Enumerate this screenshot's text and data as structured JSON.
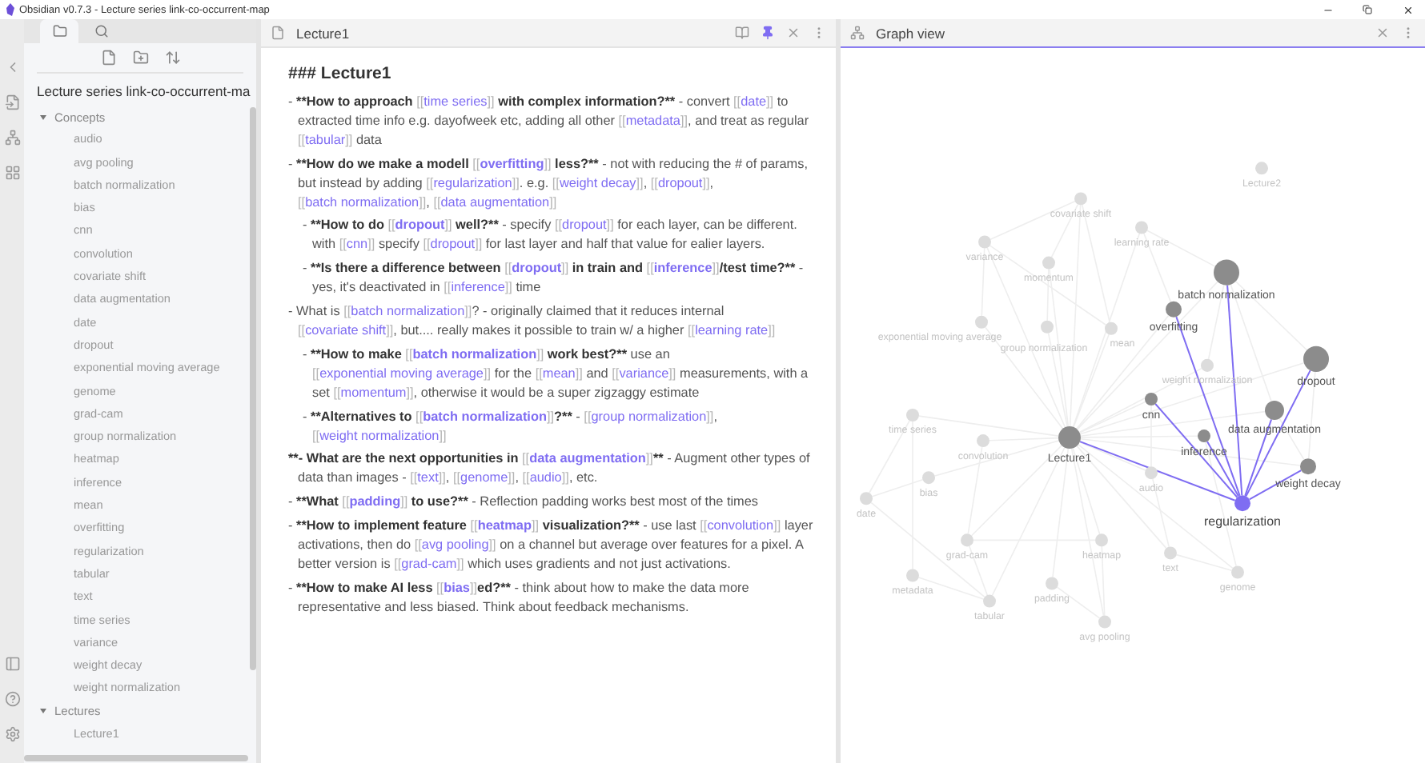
{
  "window": {
    "title": "Obsidian v0.7.3 - Lecture series link-co-occurrent-map"
  },
  "sidebar_tabs": [
    {
      "kind": "folder",
      "selected": true
    },
    {
      "kind": "search",
      "selected": false
    }
  ],
  "file_tree": {
    "vault": "Lecture series link-co-occurrent-ma",
    "folders": [
      {
        "label": "Concepts",
        "expanded": true,
        "children": [
          "audio",
          "avg pooling",
          "batch normalization",
          "bias",
          "cnn",
          "convolution",
          "covariate shift",
          "data augmentation",
          "date",
          "dropout",
          "exponential moving average",
          "genome",
          "grad-cam",
          "group normalization",
          "heatmap",
          "inference",
          "mean",
          "overfitting",
          "regularization",
          "tabular",
          "text",
          "time series",
          "variance",
          "weight decay",
          "weight normalization"
        ]
      },
      {
        "label": "Lectures",
        "expanded": true,
        "children": [
          "Lecture1"
        ]
      }
    ]
  },
  "editor": {
    "title": "Lecture1",
    "active": false,
    "pinned": true,
    "heading": "### Lecture1",
    "items": [
      {
        "parts": [
          {
            "kind": "plain",
            "text": "- "
          },
          {
            "kind": "bold",
            "text": "**How to approach "
          },
          {
            "kind": "bracket",
            "text": "[["
          },
          {
            "kind": "link",
            "text": "time series"
          },
          {
            "kind": "bracket",
            "text": "]]"
          },
          {
            "kind": "bold",
            "text": " with complex information?**"
          },
          {
            "kind": "plain",
            "text": " - convert "
          },
          {
            "kind": "bracket",
            "text": "[["
          },
          {
            "kind": "link",
            "text": "date"
          },
          {
            "kind": "bracket",
            "text": "]]"
          },
          {
            "kind": "plain",
            "text": " to extracted time info e.g. dayofweek etc, adding all other "
          },
          {
            "kind": "bracket",
            "text": "[["
          },
          {
            "kind": "link",
            "text": "metadata"
          },
          {
            "kind": "bracket",
            "text": "]]"
          },
          {
            "kind": "plain",
            "text": ", and treat as regular "
          },
          {
            "kind": "bracket",
            "text": "[["
          },
          {
            "kind": "link",
            "text": "tabular"
          },
          {
            "kind": "bracket",
            "text": "]]"
          },
          {
            "kind": "plain",
            "text": " data"
          }
        ]
      },
      {
        "parts": [
          {
            "kind": "plain",
            "text": "- "
          },
          {
            "kind": "bold",
            "text": "**How do we make a modell "
          },
          {
            "kind": "bracket",
            "text": "[["
          },
          {
            "kind": "bold_link",
            "text": "overfitting"
          },
          {
            "kind": "bracket",
            "text": "]]"
          },
          {
            "kind": "bold",
            "text": " less?**"
          },
          {
            "kind": "plain",
            "text": " - not with reducing the # of params, but instead by adding "
          },
          {
            "kind": "bracket",
            "text": "[["
          },
          {
            "kind": "link",
            "text": "regularization"
          },
          {
            "kind": "bracket",
            "text": "]]"
          },
          {
            "kind": "plain",
            "text": ". e.g. "
          },
          {
            "kind": "bracket",
            "text": "[["
          },
          {
            "kind": "link",
            "text": "weight decay"
          },
          {
            "kind": "bracket",
            "text": "]]"
          },
          {
            "kind": "plain",
            "text": ", "
          },
          {
            "kind": "bracket",
            "text": "[["
          },
          {
            "kind": "link",
            "text": "dropout"
          },
          {
            "kind": "bracket",
            "text": "]]"
          },
          {
            "kind": "plain",
            "text": ", "
          },
          {
            "kind": "bracket",
            "text": "[["
          },
          {
            "kind": "link",
            "text": "batch normalization"
          },
          {
            "kind": "bracket",
            "text": "]]"
          },
          {
            "kind": "plain",
            "text": ", "
          },
          {
            "kind": "bracket",
            "text": "[["
          },
          {
            "kind": "link",
            "text": "data augmentation"
          },
          {
            "kind": "bracket",
            "text": "]]"
          }
        ],
        "children": [
          {
            "parts": [
              {
                "kind": "plain",
                "text": "- "
              },
              {
                "kind": "bold",
                "text": "**How to do "
              },
              {
                "kind": "bracket",
                "text": "[["
              },
              {
                "kind": "bold_link",
                "text": "dropout"
              },
              {
                "kind": "bracket",
                "text": "]]"
              },
              {
                "kind": "bold",
                "text": " well?**"
              },
              {
                "kind": "plain",
                "text": " - specify "
              },
              {
                "kind": "bracket",
                "text": "[["
              },
              {
                "kind": "link",
                "text": "dropout"
              },
              {
                "kind": "bracket",
                "text": "]]"
              },
              {
                "kind": "plain",
                "text": " for each layer, can be different. with "
              },
              {
                "kind": "bracket",
                "text": "[["
              },
              {
                "kind": "link",
                "text": "cnn"
              },
              {
                "kind": "bracket",
                "text": "]]"
              },
              {
                "kind": "plain",
                "text": " specify "
              },
              {
                "kind": "bracket",
                "text": "[["
              },
              {
                "kind": "link",
                "text": "dropout"
              },
              {
                "kind": "bracket",
                "text": "]]"
              },
              {
                "kind": "plain",
                "text": " for last layer and half that value for ealier layers."
              }
            ]
          },
          {
            "parts": [
              {
                "kind": "plain",
                "text": "- "
              },
              {
                "kind": "bold",
                "text": "**Is there a difference between "
              },
              {
                "kind": "bracket",
                "text": "[["
              },
              {
                "kind": "bold_link",
                "text": "dropout"
              },
              {
                "kind": "bracket",
                "text": "]]"
              },
              {
                "kind": "bold",
                "text": " in train and "
              },
              {
                "kind": "bracket",
                "text": "[["
              },
              {
                "kind": "bold_link",
                "text": "inference"
              },
              {
                "kind": "bracket",
                "text": "]]"
              },
              {
                "kind": "bold",
                "text": "/test time?**"
              },
              {
                "kind": "plain",
                "text": " - yes, it's deactivated in "
              },
              {
                "kind": "bracket",
                "text": "[["
              },
              {
                "kind": "link",
                "text": "inference"
              },
              {
                "kind": "bracket",
                "text": "]]"
              },
              {
                "kind": "plain",
                "text": " time"
              }
            ]
          }
        ]
      },
      {
        "parts": [
          {
            "kind": "plain",
            "text": "- What is "
          },
          {
            "kind": "bracket",
            "text": "[["
          },
          {
            "kind": "link",
            "text": "batch normalization"
          },
          {
            "kind": "bracket",
            "text": "]]"
          },
          {
            "kind": "plain",
            "text": "? - originally claimed that it reduces internal "
          },
          {
            "kind": "bracket",
            "text": "[["
          },
          {
            "kind": "link",
            "text": "covariate shift"
          },
          {
            "kind": "bracket",
            "text": "]]"
          },
          {
            "kind": "plain",
            "text": ", but.... really makes it possible to train w/ a higher "
          },
          {
            "kind": "bracket",
            "text": "[["
          },
          {
            "kind": "link",
            "text": "learning rate"
          },
          {
            "kind": "bracket",
            "text": "]]"
          }
        ],
        "children": [
          {
            "parts": [
              {
                "kind": "plain",
                "text": "- "
              },
              {
                "kind": "bold",
                "text": "**How to make "
              },
              {
                "kind": "bracket",
                "text": "[["
              },
              {
                "kind": "bold_link",
                "text": "batch normalization"
              },
              {
                "kind": "bracket",
                "text": "]]"
              },
              {
                "kind": "bold",
                "text": " work best?**"
              },
              {
                "kind": "plain",
                "text": " use an "
              },
              {
                "kind": "bracket",
                "text": "[["
              },
              {
                "kind": "link",
                "text": "exponential moving average"
              },
              {
                "kind": "bracket",
                "text": "]]"
              },
              {
                "kind": "plain",
                "text": " for the "
              },
              {
                "kind": "bracket",
                "text": "[["
              },
              {
                "kind": "link",
                "text": "mean"
              },
              {
                "kind": "bracket",
                "text": "]]"
              },
              {
                "kind": "plain",
                "text": " and "
              },
              {
                "kind": "bracket",
                "text": "[["
              },
              {
                "kind": "link",
                "text": "variance"
              },
              {
                "kind": "bracket",
                "text": "]]"
              },
              {
                "kind": "plain",
                "text": " measurements, with a set "
              },
              {
                "kind": "bracket",
                "text": "[["
              },
              {
                "kind": "link",
                "text": "momentum"
              },
              {
                "kind": "bracket",
                "text": "]]"
              },
              {
                "kind": "plain",
                "text": ", otherwise it would be a super zigzaggy estimate"
              }
            ]
          },
          {
            "parts": [
              {
                "kind": "plain",
                "text": "- "
              },
              {
                "kind": "bold",
                "text": "**Alternatives to "
              },
              {
                "kind": "bracket",
                "text": "[["
              },
              {
                "kind": "bold_link",
                "text": "batch normalization"
              },
              {
                "kind": "bracket",
                "text": "]]"
              },
              {
                "kind": "bold",
                "text": "?**"
              },
              {
                "kind": "plain",
                "text": " - "
              },
              {
                "kind": "bracket",
                "text": "[["
              },
              {
                "kind": "link",
                "text": "group normalization"
              },
              {
                "kind": "bracket",
                "text": "]]"
              },
              {
                "kind": "plain",
                "text": ", "
              },
              {
                "kind": "bracket",
                "text": "[["
              },
              {
                "kind": "link",
                "text": "weight normalization"
              },
              {
                "kind": "bracket",
                "text": "]]"
              }
            ]
          }
        ]
      },
      {
        "parts": [
          {
            "kind": "bold",
            "text": "**- What are the next opportunities in "
          },
          {
            "kind": "bracket",
            "text": "[["
          },
          {
            "kind": "bold_link",
            "text": "data augmentation"
          },
          {
            "kind": "bracket",
            "text": "]]"
          },
          {
            "kind": "bold",
            "text": "**"
          },
          {
            "kind": "plain",
            "text": " - Augment other types of data than images - "
          },
          {
            "kind": "bracket",
            "text": "[["
          },
          {
            "kind": "link",
            "text": "text"
          },
          {
            "kind": "bracket",
            "text": "]]"
          },
          {
            "kind": "plain",
            "text": ", "
          },
          {
            "kind": "bracket",
            "text": "[["
          },
          {
            "kind": "link",
            "text": "genome"
          },
          {
            "kind": "bracket",
            "text": "]]"
          },
          {
            "kind": "plain",
            "text": ", "
          },
          {
            "kind": "bracket",
            "text": "[["
          },
          {
            "kind": "link",
            "text": "audio"
          },
          {
            "kind": "bracket",
            "text": "]]"
          },
          {
            "kind": "plain",
            "text": ", etc."
          }
        ]
      },
      {
        "parts": [
          {
            "kind": "plain",
            "text": "- "
          },
          {
            "kind": "bold",
            "text": "**What "
          },
          {
            "kind": "bracket",
            "text": "[["
          },
          {
            "kind": "bold_link",
            "text": "padding"
          },
          {
            "kind": "bracket",
            "text": "]]"
          },
          {
            "kind": "bold",
            "text": " to use?**"
          },
          {
            "kind": "plain",
            "text": " - Reflection padding works best most of the times"
          }
        ]
      },
      {
        "parts": [
          {
            "kind": "plain",
            "text": "- "
          },
          {
            "kind": "bold",
            "text": "**How to implement feature "
          },
          {
            "kind": "bracket",
            "text": "[["
          },
          {
            "kind": "bold_link",
            "text": "heatmap"
          },
          {
            "kind": "bracket",
            "text": "]]"
          },
          {
            "kind": "bold",
            "text": " visualization?**"
          },
          {
            "kind": "plain",
            "text": " - use last "
          },
          {
            "kind": "bracket",
            "text": "[["
          },
          {
            "kind": "link",
            "text": "convolution"
          },
          {
            "kind": "bracket",
            "text": "]]"
          },
          {
            "kind": "plain",
            "text": " layer activations, then do "
          },
          {
            "kind": "bracket",
            "text": "[["
          },
          {
            "kind": "link",
            "text": "avg pooling"
          },
          {
            "kind": "bracket",
            "text": "]]"
          },
          {
            "kind": "plain",
            "text": " on a channel but average over features for a pixel. A better version is "
          },
          {
            "kind": "bracket",
            "text": "[["
          },
          {
            "kind": "link",
            "text": "grad-cam"
          },
          {
            "kind": "bracket",
            "text": "]]"
          },
          {
            "kind": "plain",
            "text": " which uses gradients and not just activations."
          }
        ]
      },
      {
        "parts": [
          {
            "kind": "plain",
            "text": "- "
          },
          {
            "kind": "bold",
            "text": "**How to make AI less "
          },
          {
            "kind": "bracket",
            "text": "[["
          },
          {
            "kind": "bold_link",
            "text": "bias"
          },
          {
            "kind": "bracket",
            "text": "]]"
          },
          {
            "kind": "bold",
            "text": "ed?**"
          },
          {
            "kind": "plain",
            "text": " - think about how to make the data more representative and less biased. Think about feedback mechanisms."
          }
        ]
      }
    ]
  },
  "graph": {
    "title": "Graph view",
    "active": true,
    "nodes": [
      {
        "label": "Lecture2",
        "kind": "dim"
      },
      {
        "label": "covariate shift",
        "kind": "dim"
      },
      {
        "label": "learning rate",
        "kind": "dim"
      },
      {
        "label": "variance",
        "kind": "dim"
      },
      {
        "label": "momentum",
        "kind": "dim"
      },
      {
        "label": "batch normalization",
        "kind": "linked"
      },
      {
        "label": "overfitting",
        "kind": "linked"
      },
      {
        "label": "exponential moving average",
        "kind": "dim"
      },
      {
        "label": "group normalization",
        "kind": "dim"
      },
      {
        "label": "mean",
        "kind": "dim"
      },
      {
        "label": "weight normalization",
        "kind": "dim"
      },
      {
        "label": "dropout",
        "kind": "linked"
      },
      {
        "label": "cnn",
        "kind": "linked"
      },
      {
        "label": "data augmentation",
        "kind": "linked"
      },
      {
        "label": "inference",
        "kind": "linked"
      },
      {
        "label": "Lecture1",
        "kind": "linked"
      },
      {
        "label": "weight decay",
        "kind": "linked"
      },
      {
        "label": "regularization",
        "kind": "focus"
      },
      {
        "label": "time series",
        "kind": "dim"
      },
      {
        "label": "convolution",
        "kind": "dim"
      },
      {
        "label": "bias",
        "kind": "dim"
      },
      {
        "label": "date",
        "kind": "dim"
      },
      {
        "label": "audio",
        "kind": "dim"
      },
      {
        "label": "grad-cam",
        "kind": "dim"
      },
      {
        "label": "heatmap",
        "kind": "dim"
      },
      {
        "label": "text",
        "kind": "dim"
      },
      {
        "label": "genome",
        "kind": "dim"
      },
      {
        "label": "metadata",
        "kind": "dim"
      },
      {
        "label": "padding",
        "kind": "dim"
      },
      {
        "label": "tabular",
        "kind": "dim"
      },
      {
        "label": "avg pooling",
        "kind": "dim"
      }
    ]
  }
}
